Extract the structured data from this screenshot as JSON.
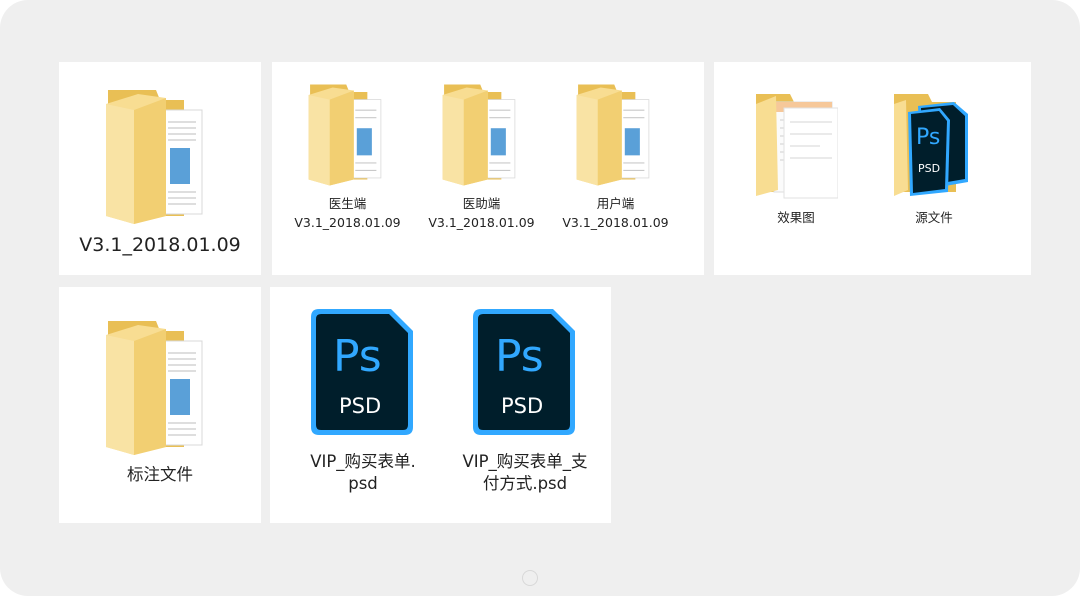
{
  "panels": {
    "main": {
      "folder": {
        "name": "V3.1_2018.01.09",
        "icon": "folder-icon"
      }
    },
    "clients": {
      "folders": [
        {
          "name": "医生端\nV3.1_2018.01.09",
          "icon": "folder-icon"
        },
        {
          "name": "医助端\nV3.1_2018.01.09",
          "icon": "folder-icon"
        },
        {
          "name": "用户端\nV3.1_2018.01.09",
          "icon": "folder-icon"
        }
      ]
    },
    "assets": {
      "folders": [
        {
          "name": "效果图",
          "icon": "folder-preview-icon"
        },
        {
          "name": "源文件",
          "icon": "folder-ps-icon",
          "badge": "Ps",
          "badge_sub": "PSD"
        }
      ]
    },
    "annotation": {
      "folder": {
        "name": "标注文件",
        "icon": "folder-icon"
      }
    },
    "files": {
      "psd": [
        {
          "name": "VIP_购买表单.\npsd",
          "icon": "psd-file-icon",
          "logo": "Ps",
          "ext": "PSD"
        },
        {
          "name": "VIP_购买表单_支\n付方式.psd",
          "icon": "psd-file-icon",
          "logo": "Ps",
          "ext": "PSD"
        }
      ]
    }
  },
  "colors": {
    "background": "#efefef",
    "panel": "#ffffff",
    "folder_back": "#f2cf72",
    "folder_front": "#f8dd92",
    "ps_dark": "#001e2b",
    "ps_blue": "#31a8ff"
  }
}
